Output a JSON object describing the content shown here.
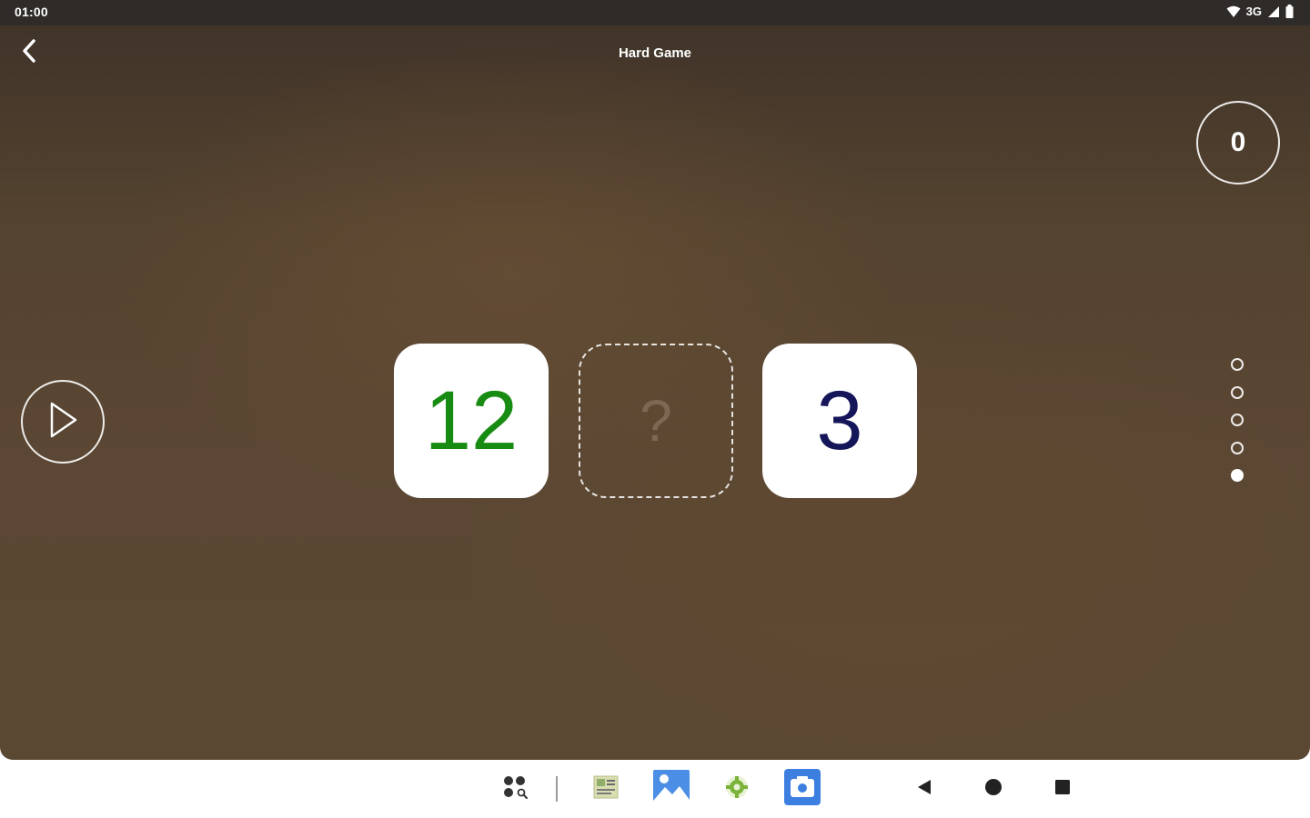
{
  "status_bar": {
    "time": "01:00",
    "network": "3G",
    "icons": [
      "wifi-icon",
      "signal-icon",
      "battery-icon"
    ]
  },
  "header": {
    "title": "Hard Game",
    "back_icon": "chevron-left-icon"
  },
  "score": {
    "value": "0"
  },
  "puzzle": {
    "left_number": "12",
    "placeholder": "?",
    "right_number": "3",
    "colors": {
      "left_number": "#188c12",
      "right_number": "#15165a"
    }
  },
  "pager": {
    "total": 5,
    "active_index": 4
  },
  "taskbar": {
    "icons": [
      "app-drawer-icon",
      "gallery-thumbnail-icon",
      "photos-icon",
      "android-settings-icon",
      "camera-icon"
    ],
    "nav": [
      "back-triangle-icon",
      "home-circle-icon",
      "recents-square-icon"
    ]
  }
}
